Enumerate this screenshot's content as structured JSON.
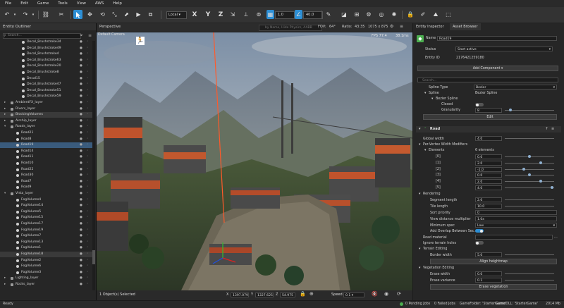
{
  "menu": [
    "File",
    "Edit",
    "Game",
    "Tools",
    "View",
    "AWS",
    "Help"
  ],
  "toolbar": {
    "coord_mode": "Local",
    "axes": [
      "X",
      "Y",
      "Z"
    ],
    "grid_size": "1.0",
    "angle_snap": "40.0"
  },
  "outliner": {
    "title": "Entity Outliner",
    "search_placeholder": "Search...",
    "rows": [
      {
        "label": "Decal_Brushstroke34",
        "depth": 2
      },
      {
        "label": "Decal_Brushstroke49",
        "depth": 2
      },
      {
        "label": "Decal_Brushstroke4",
        "depth": 2
      },
      {
        "label": "Decal_Brushstroke63",
        "depth": 2
      },
      {
        "label": "Decal_Brushstroke20",
        "depth": 2
      },
      {
        "label": "Decal_Brushstroke8",
        "depth": 2
      },
      {
        "label": "Decal15",
        "depth": 2
      },
      {
        "label": "Decal_Brushstroke47",
        "depth": 2
      },
      {
        "label": "Decal_Brushstroke51",
        "depth": 2
      },
      {
        "label": "Decal_Brushstroke59",
        "depth": 2
      },
      {
        "label": "AmbientFX_layer",
        "depth": 0,
        "caret": "▸"
      },
      {
        "label": "Rivers_layer",
        "depth": 0,
        "caret": "▸"
      },
      {
        "label": "BlockingVolumes",
        "depth": 0,
        "caret": "▸",
        "hl": true
      },
      {
        "label": "Airship_layer",
        "depth": 0,
        "caret": "▸"
      },
      {
        "label": "Roads_layer",
        "depth": 0,
        "caret": "▾"
      },
      {
        "label": "Road21",
        "depth": 1
      },
      {
        "label": "Road8",
        "depth": 1
      },
      {
        "label": "Road19",
        "depth": 1,
        "sel": true
      },
      {
        "label": "Road14",
        "depth": 1
      },
      {
        "label": "Road11",
        "depth": 1
      },
      {
        "label": "Road10",
        "depth": 1
      },
      {
        "label": "Road22",
        "depth": 1
      },
      {
        "label": "Road30",
        "depth": 1
      },
      {
        "label": "Road7",
        "depth": 1
      },
      {
        "label": "Road9",
        "depth": 1
      },
      {
        "label": "Vista_layer",
        "depth": 0,
        "caret": "▾"
      },
      {
        "label": "FogVolume4",
        "depth": 1
      },
      {
        "label": "FogVolume14",
        "depth": 1
      },
      {
        "label": "FogVolume5",
        "depth": 1
      },
      {
        "label": "FogVolume15",
        "depth": 1
      },
      {
        "label": "FogVolume17",
        "depth": 1
      },
      {
        "label": "FogVolume19",
        "depth": 1
      },
      {
        "label": "FogVolume7",
        "depth": 1
      },
      {
        "label": "FogVolume13",
        "depth": 1
      },
      {
        "label": "FogVolume1",
        "depth": 1
      },
      {
        "label": "FogVolume18",
        "depth": 1,
        "hl": true
      },
      {
        "label": "FogVolume2",
        "depth": 1
      },
      {
        "label": "FogVolume6",
        "depth": 1
      },
      {
        "label": "FogVolume3",
        "depth": 1
      },
      {
        "label": "Lighting_layer",
        "depth": 0,
        "caret": "▸"
      },
      {
        "label": "Rocks_layer",
        "depth": 0,
        "caret": "▸"
      }
    ]
  },
  "viewport": {
    "tab": "Perspective",
    "camera_label": "Default Camera",
    "search_placeholder": "by Name, Hide Physics, AABB",
    "fov_label": "FOV:",
    "fov_value": "64°",
    "ratio_label": "Ratio:",
    "ratio_value": "43:35",
    "resolution": "1075 x 875",
    "fps": "FPS 77.4",
    "ms": "38.1ms",
    "selection_status": "1 Object(s) Selected",
    "pos_x": "1397.079",
    "pos_y": "1327.625",
    "pos_z": "54.975",
    "speed_label": "Speed",
    "speed_value": "0.1"
  },
  "inspector": {
    "tab_entity": "Entity Inspector",
    "tab_asset": "Asset Browser",
    "name_label": "Name",
    "name_value": "Road19",
    "status_label": "Status",
    "status_value": "Start active",
    "entity_id_label": "Entity ID",
    "entity_id_value": "2176421259180",
    "add_component": "Add Component ▾",
    "search_placeholder": "Search...",
    "spline_type_label": "Spline Type",
    "spline_type_value": "Bezier",
    "spline_label": "Spline",
    "spline_value": "Bezier Spline",
    "bezier_label": "Bezier Spline",
    "closed_label": "Closed",
    "granularity_label": "Granularity",
    "granularity_value": "8",
    "edit_button": "Edit",
    "road_header": "Road",
    "global_width_label": "Global width",
    "global_width_value": "4.0",
    "per_vertex_label": "Per-Vertex Width Modifiers",
    "elements_label": "Elements",
    "elements_value": "6 elements",
    "elements": [
      {
        "index": "[0]",
        "value": "0.0"
      },
      {
        "index": "[1]",
        "value": "2.0"
      },
      {
        "index": "[2]",
        "value": "-1.0"
      },
      {
        "index": "[3]",
        "value": "0.0"
      },
      {
        "index": "[4]",
        "value": "2.0"
      },
      {
        "index": "[5]",
        "value": "4.0"
      }
    ],
    "rendering_label": "Rendering",
    "segment_length_label": "Segment length",
    "segment_length_value": "2.0",
    "tile_length_label": "Tile length",
    "tile_length_value": "10.0",
    "sort_priority_label": "Sort priority",
    "sort_priority_value": "0",
    "view_distance_label": "View distance multiplier",
    "view_distance_value": "1.0x",
    "min_spec_label": "Minimum spec",
    "min_spec_value": "Low",
    "add_overlap_label": "Add Overlap Between Sec...",
    "road_material_label": "Road material",
    "ignore_terrain_label": "Ignore terrain holes",
    "terrain_editing_label": "Terrain Editing",
    "border_width_label": "Border width",
    "border_width_value": "5.0",
    "align_heightmap": "Align heightmap",
    "vegetation_label": "Vegetation Editing",
    "erase_width_label": "Erase width",
    "erase_width_value": "0.0",
    "erase_variance_label": "Erase variance",
    "erase_variance_value": "0.1",
    "erase_vegetation": "Erase vegetation"
  },
  "statusbar": {
    "ready": "Ready",
    "pending_jobs": "0 Pending Jobs",
    "failed_jobs": "0 Failed Jobs",
    "game_folder": "GameFolder: 'StarterGame'",
    "game_dll": "GameDLL: 'StarterGame'",
    "memory": "2014 Mb"
  },
  "colors": {
    "accent": "#2d8fd5",
    "selection": "#3a5b7c",
    "laser": "#ff5a2a"
  }
}
